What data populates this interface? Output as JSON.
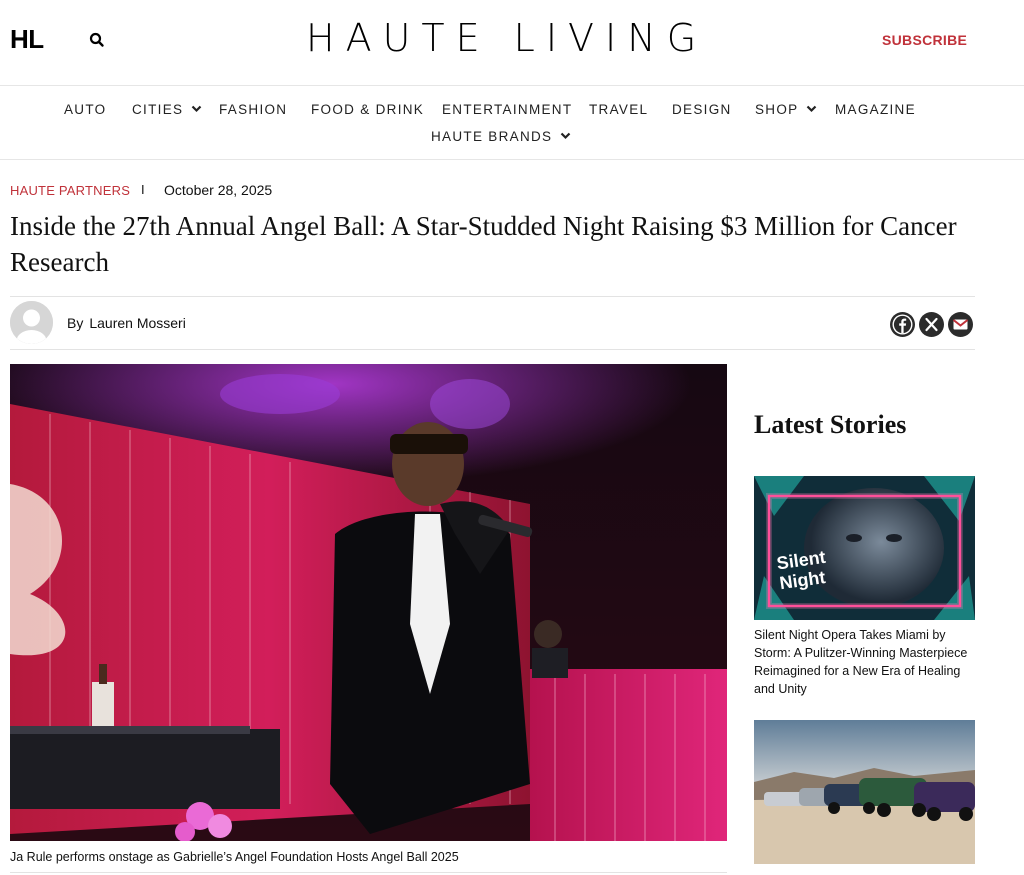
{
  "header": {
    "logo_short": "HL",
    "brand": "HAUTE LIVING",
    "subscribe_label": "SUBSCRIBE"
  },
  "nav": {
    "items": [
      {
        "label": "AUTO"
      },
      {
        "label": "CITIES"
      },
      {
        "label": "FASHION"
      },
      {
        "label": "FOOD & DRINK"
      },
      {
        "label": "ENTERTAINMENT"
      },
      {
        "label": "TRAVEL"
      },
      {
        "label": "DESIGN"
      },
      {
        "label": "SHOP"
      },
      {
        "label": "MAGAZINE"
      },
      {
        "label": "HAUTE BRANDS"
      }
    ]
  },
  "article": {
    "category": "HAUTE PARTNERS",
    "separator": "I",
    "date": "October 28, 2025",
    "headline": "Inside the 27th Annual Angel Ball: A Star-Studded Night Raising $3 Million for Cancer Research",
    "author_prefix": "By",
    "author": "Lauren Mosseri",
    "caption": "Ja Rule performs onstage as Gabrielle’s Angel Foundation Hosts Angel Ball 2025"
  },
  "sidebar": {
    "heading": "Latest Stories",
    "stories": [
      {
        "thumb_text_1": "Silent",
        "thumb_text_2": "Night",
        "title": "Silent Night Opera Takes Miami by Storm: A Pulitzer-Winning Masterpiece Reimagined for a New Era of Healing and Unity"
      },
      {
        "title": ""
      }
    ]
  },
  "colors": {
    "accent": "#c0323a",
    "text": "#111111",
    "rule": "#e3e3e3"
  },
  "icons": [
    "search-icon",
    "chevron-down-icon",
    "facebook-icon",
    "x-icon",
    "email-icon",
    "avatar-placeholder-icon"
  ]
}
